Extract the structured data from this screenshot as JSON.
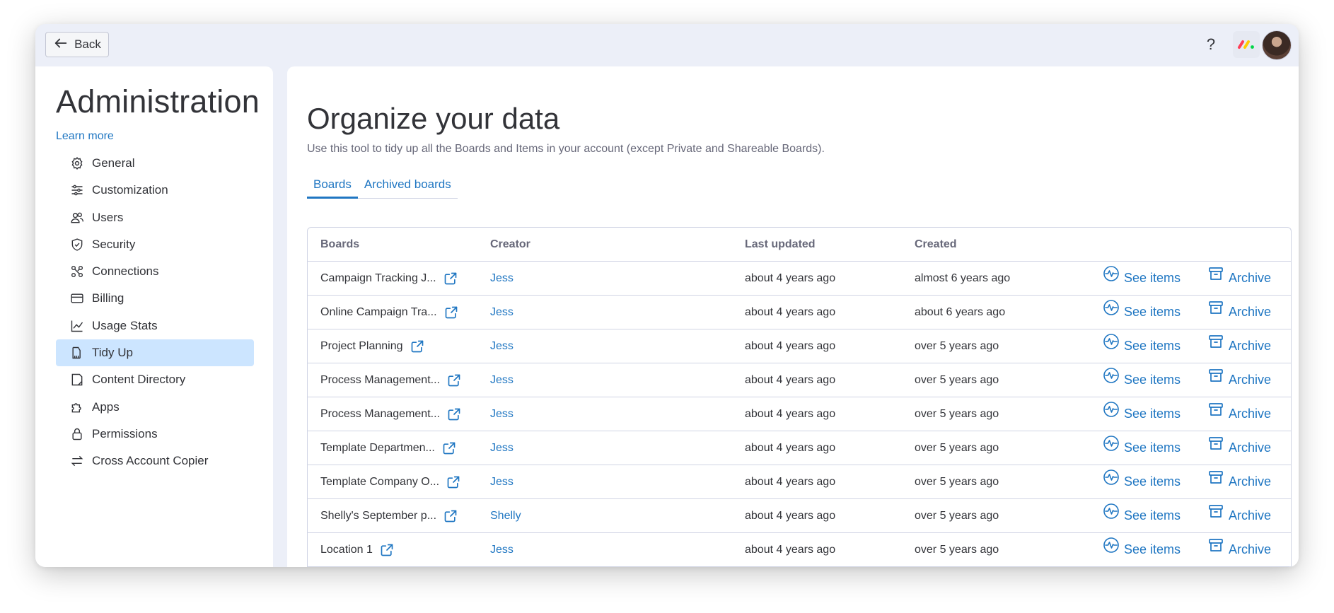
{
  "topbar": {
    "back_label": "Back",
    "help_symbol": "?",
    "icons": [
      "arrow-left-icon",
      "help-icon",
      "monday-logo-icon",
      "avatar"
    ]
  },
  "sidebar": {
    "title": "Administration",
    "learn_more": "Learn more",
    "items": [
      {
        "label": "General",
        "icon": "gear-icon"
      },
      {
        "label": "Customization",
        "icon": "sliders-icon"
      },
      {
        "label": "Users",
        "icon": "users-icon"
      },
      {
        "label": "Security",
        "icon": "shield-icon"
      },
      {
        "label": "Connections",
        "icon": "connections-icon"
      },
      {
        "label": "Billing",
        "icon": "credit-card-icon"
      },
      {
        "label": "Usage Stats",
        "icon": "chart-icon"
      },
      {
        "label": "Tidy Up",
        "icon": "broom-icon",
        "active": true
      },
      {
        "label": "Content Directory",
        "icon": "document-icon"
      },
      {
        "label": "Apps",
        "icon": "puzzle-icon"
      },
      {
        "label": "Permissions",
        "icon": "lock-icon"
      },
      {
        "label": "Cross Account Copier",
        "icon": "swap-arrows-icon"
      }
    ]
  },
  "main": {
    "title": "Organize your data",
    "subtitle": "Use this tool to tidy up all the Boards and Items in your account (except Private and Shareable Boards).",
    "tabs": [
      {
        "label": "Boards",
        "active": true
      },
      {
        "label": "Archived boards",
        "active": false
      }
    ],
    "table": {
      "headers": {
        "board": "Boards",
        "creator": "Creator",
        "updated": "Last updated",
        "created": "Created"
      },
      "action_see": "See items",
      "action_archive": "Archive",
      "rows": [
        {
          "board": "Campaign Tracking J...",
          "creator": "Jess",
          "updated": "about 4 years ago",
          "created": "almost 6 years ago"
        },
        {
          "board": "Online Campaign Tra...",
          "creator": "Jess",
          "updated": "about 4 years ago",
          "created": "about 6 years ago"
        },
        {
          "board": "Project Planning",
          "creator": "Jess",
          "updated": "about 4 years ago",
          "created": "over 5 years ago"
        },
        {
          "board": "Process Management...",
          "creator": "Jess",
          "updated": "about 4 years ago",
          "created": "over 5 years ago"
        },
        {
          "board": "Process Management...",
          "creator": "Jess",
          "updated": "about 4 years ago",
          "created": "over 5 years ago"
        },
        {
          "board": "Template Departmen...",
          "creator": "Jess",
          "updated": "about 4 years ago",
          "created": "over 5 years ago"
        },
        {
          "board": "Template Company O...",
          "creator": "Jess",
          "updated": "about 4 years ago",
          "created": "over 5 years ago"
        },
        {
          "board": "Shelly's September p...",
          "creator": "Shelly",
          "updated": "about 4 years ago",
          "created": "over 5 years ago"
        },
        {
          "board": "Location 1",
          "creator": "Jess",
          "updated": "about 4 years ago",
          "created": "over 5 years ago"
        }
      ]
    }
  },
  "colors": {
    "accent": "#1f76c2",
    "active_nav": "#cce5ff",
    "window_bg": "#eceff8",
    "border": "#d0d4e4"
  }
}
